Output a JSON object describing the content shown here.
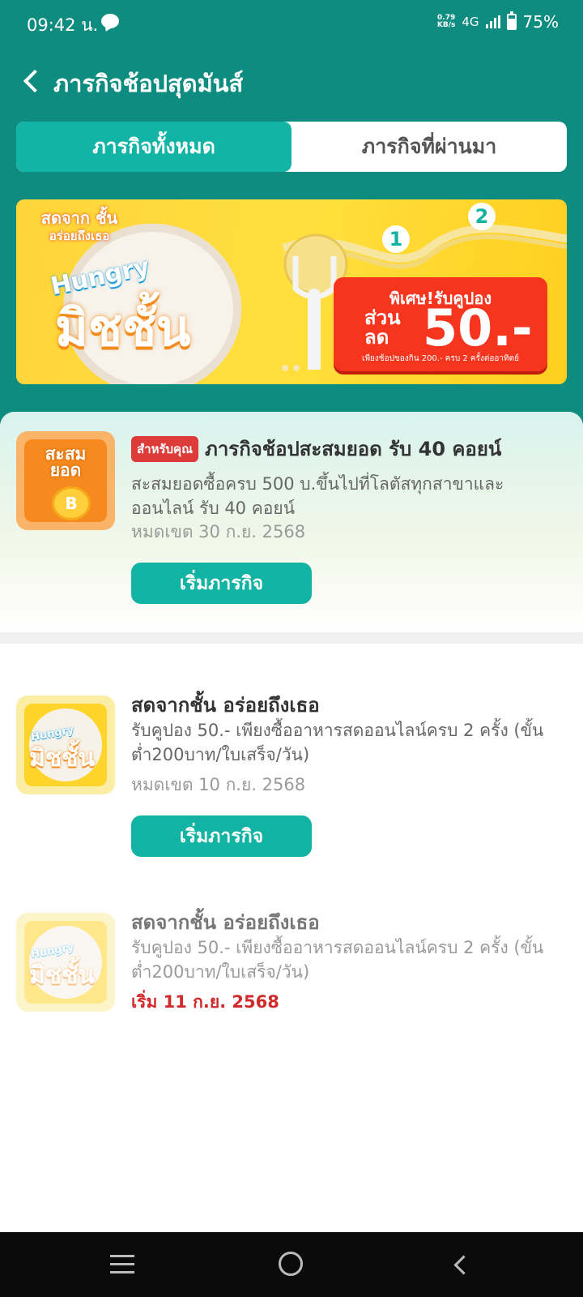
{
  "status_bar": {
    "time": "09:42 น.",
    "net_speed_value": "0.79",
    "net_speed_unit": "KB/s",
    "network": "4G",
    "battery": "75%"
  },
  "header": {
    "title": "ภารกิจช้อปสุดมันส์"
  },
  "tabs": [
    {
      "label": "ภารกิจทั้งหมด",
      "active": true
    },
    {
      "label": "ภารกิจที่ผ่านมา",
      "active": false
    }
  ],
  "banner": {
    "tag_line1": "สดจาก ชั้น",
    "tag_line2": "อร่อยถึงเธอ",
    "hungry": "Hungry",
    "brand": "มิชชั้น",
    "coupon_head": "พิเศษ!รับคูปอง",
    "coupon_discount_1": "ส่วน",
    "coupon_discount_2": "ลด",
    "coupon_amount": "50.-",
    "coupon_note": "เพียงช้อปของกิน 200.- ครบ 2 ครั้งต่ออาทิตย์",
    "step1": "1",
    "step2": "2"
  },
  "missions": [
    {
      "badge": "สำหรับคุณ",
      "thumb_label_1": "สะสม",
      "thumb_label_2": "ยอด",
      "coin_symbol": "B",
      "title": "ภารกิจช้อปสะสมยอด รับ 40 คอยน์",
      "desc": "สะสมยอดซื้อครบ 500 บ.ขึ้นไปที่โลตัสทุกสาขาและออนไลน์ รับ 40 คอยน์",
      "expire": "หมดเขต 30 ก.ย. 2568",
      "button": "เริ่มภารกิจ"
    },
    {
      "thumb_t1": "Hungry",
      "thumb_t2": "มิชชั้น",
      "title": "สดจากชั้น อร่อยถึงเธอ",
      "desc": "รับคูปอง 50.- เพียงซื้ออาหารสดออนไลน์ครบ 2 ครั้ง (ขั้นต่ำ200บาท/ใบเสร็จ/วัน)",
      "expire": "หมดเขต 10 ก.ย. 2568",
      "button": "เริ่มภารกิจ"
    },
    {
      "thumb_t1": "Hungry",
      "thumb_t2": "มิชชั้น",
      "title": "สดจากชั้น อร่อยถึงเธอ",
      "desc": "รับคูปอง 50.- เพียงซื้ออาหารสดออนไลน์ครบ 2 ครั้ง (ขั้นต่ำ200บาท/ใบเสร็จ/วัน)",
      "start": "เริ่ม 11 ก.ย. 2568"
    }
  ],
  "colors": {
    "brand_teal": "#0e8c80",
    "button_teal": "#13b3a3",
    "badge_red": "#dd3a3a",
    "start_date_red": "#d12a2a"
  }
}
